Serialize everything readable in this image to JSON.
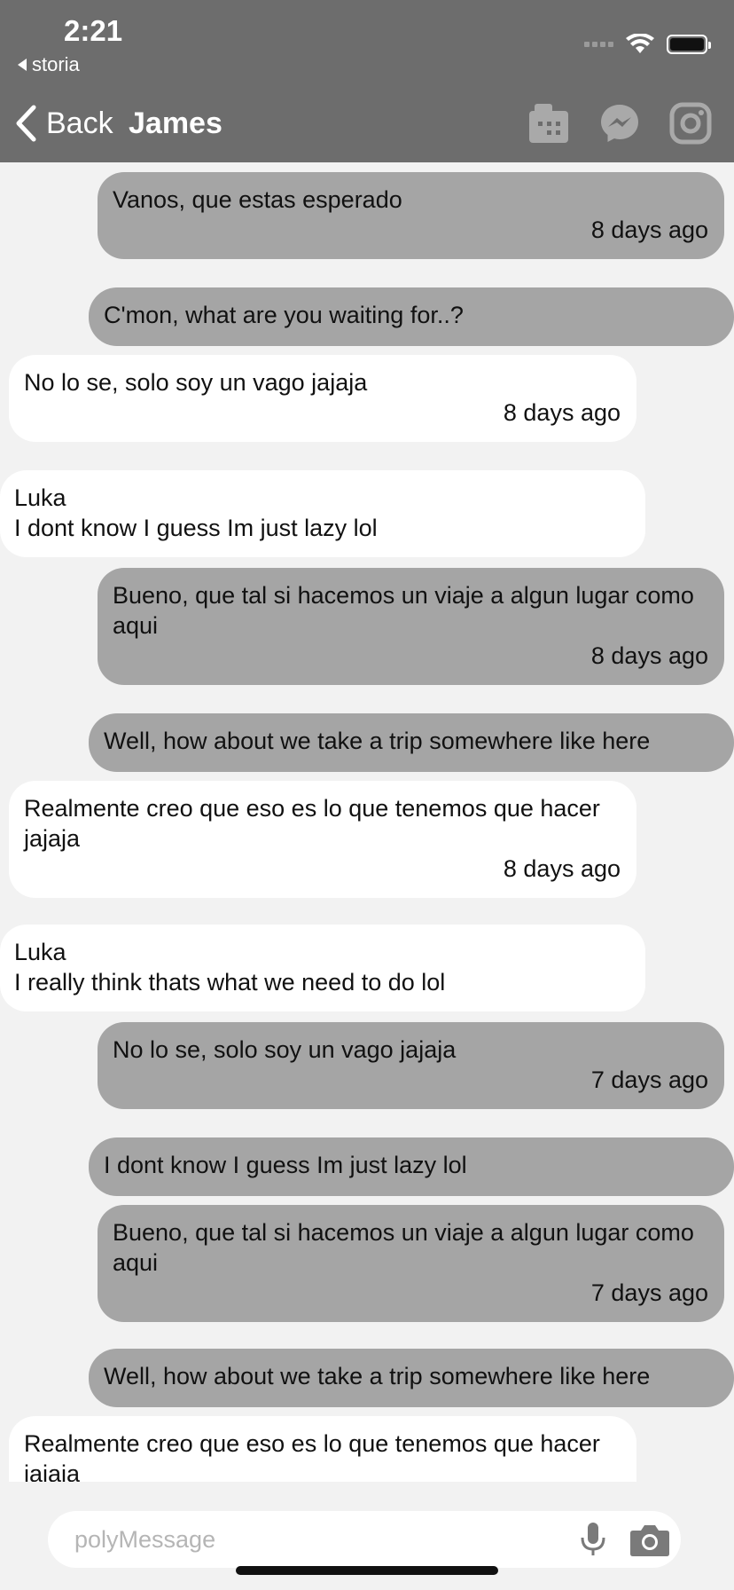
{
  "status": {
    "time": "2:21",
    "back_app": "storia"
  },
  "nav": {
    "back_label": "Back",
    "title": "James",
    "icons": [
      "film-icon",
      "messenger-icon",
      "instagram-icon"
    ]
  },
  "messages": [
    {
      "type": "sent",
      "text": "Vanos, que estas esperado",
      "time": "8 days ago"
    },
    {
      "type": "sent-plain",
      "text": "C'mon, what are you waiting for..?"
    },
    {
      "type": "recv",
      "text": "No lo se, solo soy un vago jajaja",
      "time": "8 days ago"
    },
    {
      "type": "recv-plain",
      "sender": "Luka",
      "text": "I dont know I guess Im just lazy lol"
    },
    {
      "type": "sent",
      "text": "Bueno, que tal si hacemos un viaje a algun lugar como aqui",
      "time": "8 days ago"
    },
    {
      "type": "sent-plain",
      "text": "Well, how about we take a trip somewhere like here"
    },
    {
      "type": "recv",
      "text": "Realmente creo que eso es lo que tenemos que hacer jajaja",
      "time": "8 days ago"
    },
    {
      "type": "recv-plain",
      "sender": "Luka",
      "text": "I really think thats what we need to do lol"
    },
    {
      "type": "sent",
      "text": "No lo se, solo soy un vago jajaja",
      "time": "7 days ago"
    },
    {
      "type": "sent-plain",
      "text": "I dont know I guess Im just lazy lol"
    },
    {
      "type": "sent",
      "text": "Bueno, que tal si hacemos un viaje a algun lugar como aqui",
      "time": "7 days ago"
    },
    {
      "type": "sent-plain",
      "text": "Well, how about we take a trip somewhere like here"
    },
    {
      "type": "recv",
      "text": "Realmente creo que eso es lo que tenemos que hacer jajaja",
      "time": ""
    }
  ],
  "composer": {
    "placeholder": "polyMessage",
    "value": ""
  },
  "colors": {
    "header_bg": "#6d6d6d",
    "sent_bubble": "#a5a5a5",
    "received_bubble": "#ffffff",
    "background": "#f2f2f2"
  }
}
